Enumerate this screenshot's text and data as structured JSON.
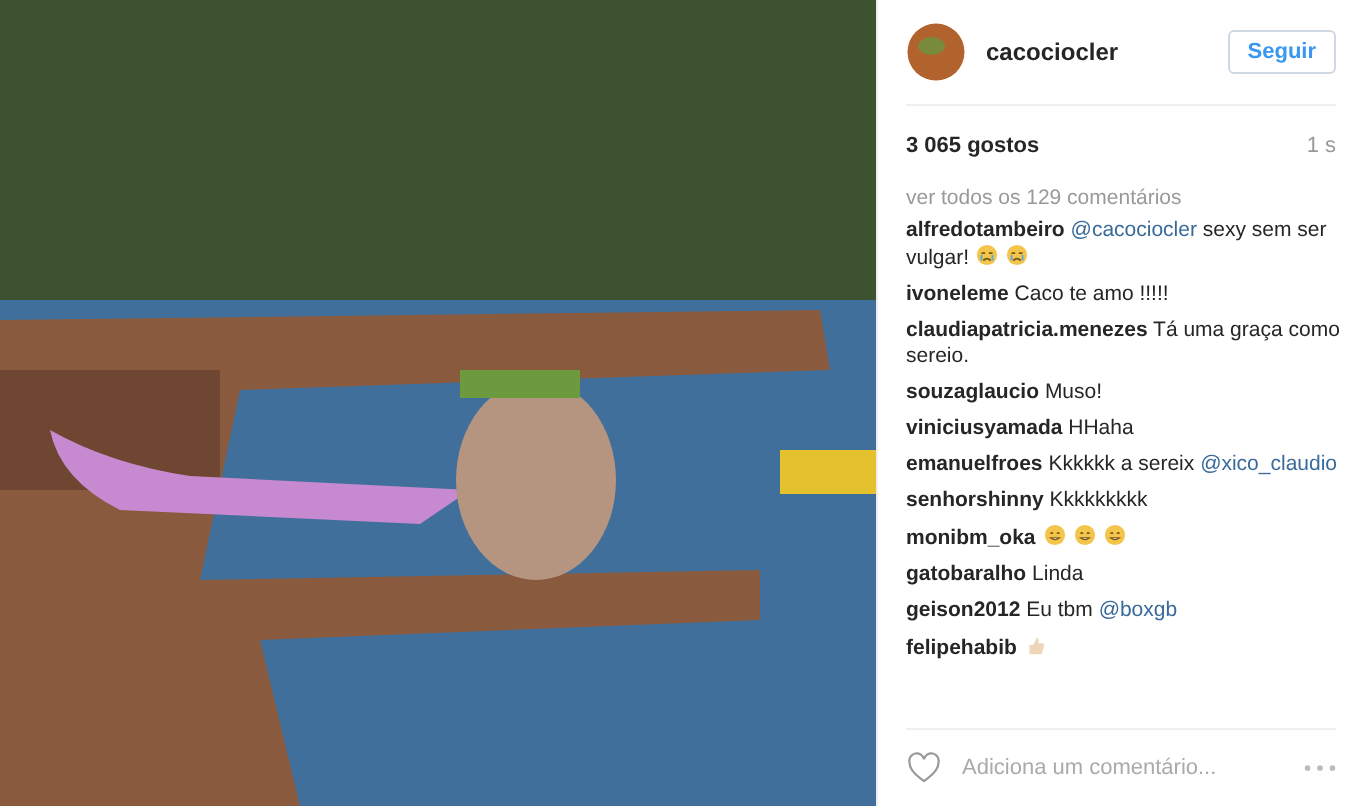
{
  "header": {
    "username": "cacociocler",
    "follow_button": "Seguir"
  },
  "likes": "3 065 gostos",
  "time": "1 s",
  "view_all": "ver todos os 129 comentários",
  "comments": [
    {
      "user": "alfredotambeiro",
      "parts": [
        {
          "kind": "mention",
          "text": "@cacociocler"
        },
        {
          "kind": "text",
          "text": "sexy sem ser vulgar!"
        },
        {
          "kind": "crying"
        },
        {
          "kind": "crying"
        }
      ]
    },
    {
      "user": "ivoneleme",
      "parts": [
        {
          "kind": "text",
          "text": "Caco te amo !!!!!"
        }
      ]
    },
    {
      "user": "claudiapatricia.menezes",
      "parts": [
        {
          "kind": "text",
          "text": "Tá uma graça como sereio."
        }
      ]
    },
    {
      "user": "souzaglaucio",
      "parts": [
        {
          "kind": "text",
          "text": "Muso!"
        }
      ]
    },
    {
      "user": "viniciusyamada",
      "parts": [
        {
          "kind": "text",
          "text": "HHaha"
        }
      ]
    },
    {
      "user": "emanuelfroes",
      "parts": [
        {
          "kind": "text",
          "text": "Kkkkkk a sereix"
        },
        {
          "kind": "mention",
          "text": "@xico_claudio"
        }
      ]
    },
    {
      "user": "senhorshinny",
      "parts": [
        {
          "kind": "text",
          "text": "Kkkkkkkkk"
        }
      ]
    },
    {
      "user": "monibm_oka",
      "parts": [
        {
          "kind": "grin"
        },
        {
          "kind": "grin"
        },
        {
          "kind": "grin"
        }
      ]
    },
    {
      "user": "gatobaralho",
      "parts": [
        {
          "kind": "text",
          "text": "Linda"
        }
      ]
    },
    {
      "user": "geison2012",
      "parts": [
        {
          "kind": "text",
          "text": "Eu tbm"
        },
        {
          "kind": "mention",
          "text": "@boxgb"
        }
      ]
    },
    {
      "user": "felipehabib",
      "parts": [
        {
          "kind": "thumb"
        }
      ]
    }
  ],
  "comment_field": {
    "placeholder": "Adiciona um comentário..."
  }
}
